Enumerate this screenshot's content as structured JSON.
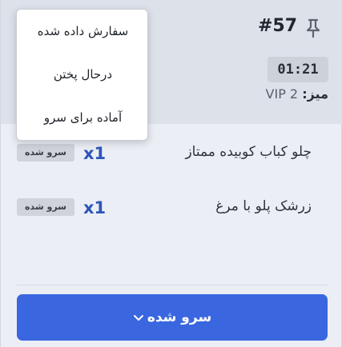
{
  "order": {
    "number": "#57",
    "timer": "01:21",
    "table_label": "میز:",
    "table_value": "VIP 2"
  },
  "items": [
    {
      "name": "چلو کباب کوبیده ممتاز",
      "quantity": "x1",
      "status": "سرو شده"
    },
    {
      "name": "زرشک پلو با مرغ",
      "quantity": "x1",
      "status": "سرو شده"
    }
  ],
  "status_button": {
    "label": "سرو شده"
  },
  "status_menu": {
    "options": [
      "سفارش داده شده",
      "درحال پختن",
      "آماده برای سرو"
    ]
  },
  "icons": {
    "pin": "pin-icon",
    "chevron": "chevron-down-icon"
  },
  "colors": {
    "accent": "#3a67e0",
    "quantity": "#2e55b8",
    "header_bg": "#dde1ea",
    "card_bg": "#eceef6"
  }
}
